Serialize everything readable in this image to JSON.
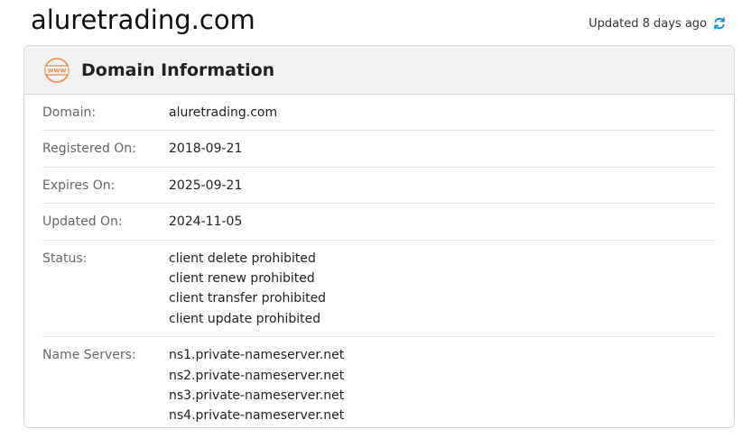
{
  "page": {
    "domain_title": "aluretrading.com",
    "updated_text": "Updated 8 days ago"
  },
  "card": {
    "title": "Domain Information",
    "icon_text": "www",
    "rows": [
      {
        "label": "Domain:",
        "values": [
          "aluretrading.com"
        ]
      },
      {
        "label": "Registered On:",
        "values": [
          "2018-09-21"
        ]
      },
      {
        "label": "Expires On:",
        "values": [
          "2025-09-21"
        ]
      },
      {
        "label": "Updated On:",
        "values": [
          "2024-11-05"
        ]
      },
      {
        "label": "Status:",
        "values": [
          "client delete prohibited",
          "client renew prohibited",
          "client transfer prohibited",
          "client update prohibited"
        ]
      },
      {
        "label": "Name Servers:",
        "values": [
          "ns1.private-nameserver.net",
          "ns2.private-nameserver.net",
          "ns3.private-nameserver.net",
          "ns4.private-nameserver.net"
        ]
      }
    ]
  },
  "colors": {
    "icon_accent": "#f08a4b",
    "refresh_accent": "#1a8fd6"
  }
}
